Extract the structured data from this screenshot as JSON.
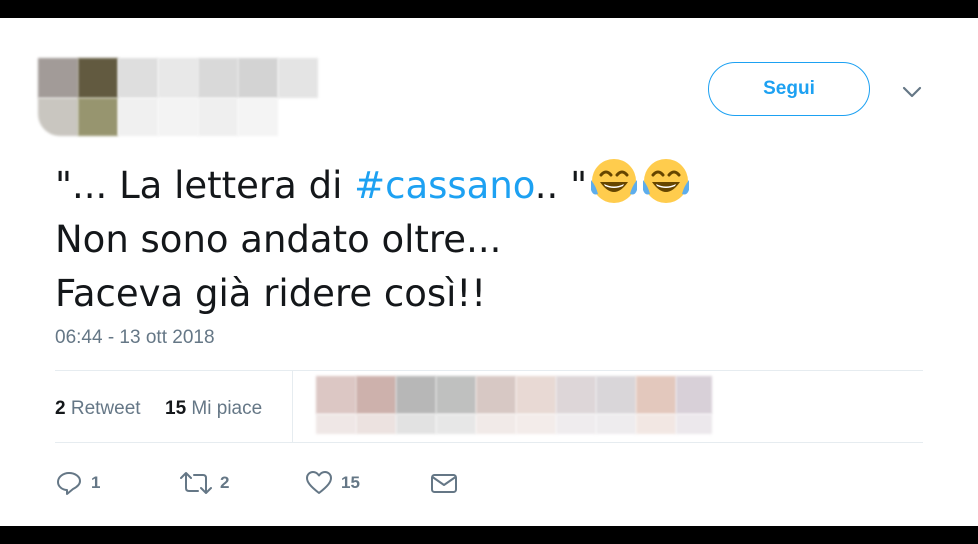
{
  "header": {
    "follow_label": "Segui"
  },
  "tweet": {
    "line1_prefix": "\"... La lettera di ",
    "hashtag": "#cassano",
    "line1_suffix": ".. \"",
    "line2": "Non sono andato oltre...",
    "line3": "Faceva già ridere così!!",
    "emoji": [
      "face-with-tears-of-joy",
      "face-with-tears-of-joy"
    ],
    "timestamp": "06:44 - 13 ott 2018"
  },
  "stats": {
    "retweets_count": "2",
    "retweets_label": "Retweet",
    "likes_count": "15",
    "likes_label": "Mi piace"
  },
  "actions": {
    "reply_count": "1",
    "retweet_count": "2",
    "like_count": "15"
  },
  "colors": {
    "accent": "#1da1f2",
    "text": "#14171a",
    "muted": "#657786",
    "divider": "#e6ecf0"
  }
}
